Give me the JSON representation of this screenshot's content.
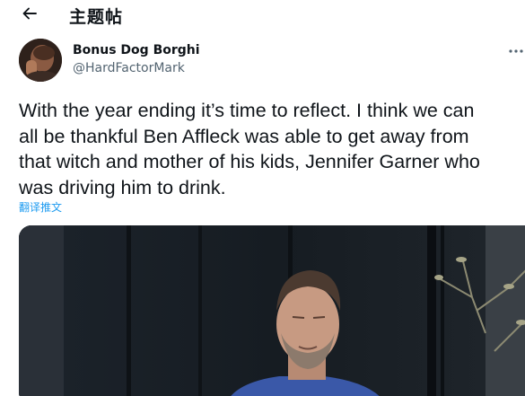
{
  "header": {
    "title": "主题帖",
    "back_icon": "arrow-left-icon"
  },
  "author": {
    "display_name": "Bonus Dog Borghi",
    "handle": "@HardFactorMark",
    "avatar_icon": "profile-photo"
  },
  "tweet": {
    "text": "With the year ending it’s time to reflect. I think we can\nall be thankful Ben Affleck was able to get away from\nthat witch and mother of his kids, Jennifer Garner who\nwas driving him to drink.",
    "translate_label": "翻译推文",
    "more_icon": "more-horizontal-icon",
    "media_icon": "photo-man-eyes-closed"
  },
  "colors": {
    "accent": "#1d9bf0",
    "text": "#0f1419",
    "muted": "#536471"
  }
}
